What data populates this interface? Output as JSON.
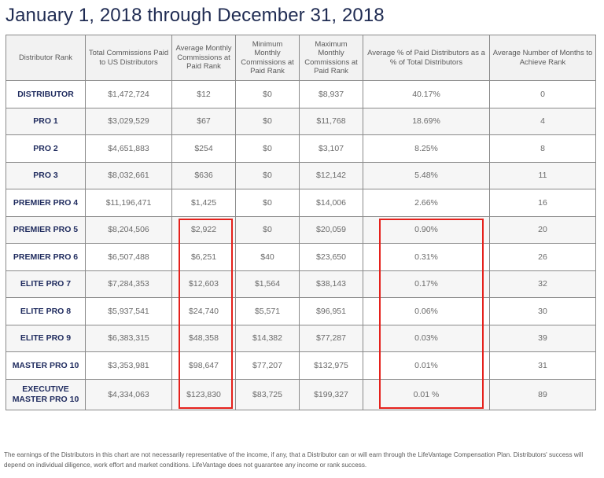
{
  "title": "January 1, 2018 through December 31, 2018",
  "table": {
    "headers": [
      "Distributor Rank",
      "Total Commissions Paid to US Distributors",
      "Average Monthly Commissions at Paid Rank",
      "Minimum Monthly Commissions at Paid Rank",
      "Maximum Monthly Commissions at Paid Rank",
      "Average % of Paid Distributors as a % of Total Distributors",
      "Average Number of Months to Achieve Rank"
    ],
    "rows": [
      {
        "rank": "DISTRIBUTOR",
        "total": "$1,472,724",
        "avg": "$12",
        "min": "$0",
        "max": "$8,937",
        "pct": "40.17%",
        "months": "0"
      },
      {
        "rank": "PRO 1",
        "total": "$3,029,529",
        "avg": "$67",
        "min": "$0",
        "max": "$11,768",
        "pct": "18.69%",
        "months": "4"
      },
      {
        "rank": "PRO 2",
        "total": "$4,651,883",
        "avg": "$254",
        "min": "$0",
        "max": "$3,107",
        "pct": "8.25%",
        "months": "8"
      },
      {
        "rank": "PRO 3",
        "total": "$8,032,661",
        "avg": "$636",
        "min": "$0",
        "max": "$12,142",
        "pct": "5.48%",
        "months": "11"
      },
      {
        "rank": "PREMIER PRO 4",
        "total": "$11,196,471",
        "avg": "$1,425",
        "min": "$0",
        "max": "$14,006",
        "pct": "2.66%",
        "months": "16"
      },
      {
        "rank": "PREMIER PRO 5",
        "total": "$8,204,506",
        "avg": "$2,922",
        "min": "$0",
        "max": "$20,059",
        "pct": "0.90%",
        "months": "20"
      },
      {
        "rank": "PREMIER PRO 6",
        "total": "$6,507,488",
        "avg": "$6,251",
        "min": "$40",
        "max": "$23,650",
        "pct": "0.31%",
        "months": "26"
      },
      {
        "rank": "ELITE PRO 7",
        "total": "$7,284,353",
        "avg": "$12,603",
        "min": "$1,564",
        "max": "$38,143",
        "pct": "0.17%",
        "months": "32"
      },
      {
        "rank": "ELITE PRO 8",
        "total": "$5,937,541",
        "avg": "$24,740",
        "min": "$5,571",
        "max": "$96,951",
        "pct": "0.06%",
        "months": "30"
      },
      {
        "rank": "ELITE PRO 9",
        "total": "$6,383,315",
        "avg": "$48,358",
        "min": "$14,382",
        "max": "$77,287",
        "pct": "0.03%",
        "months": "39"
      },
      {
        "rank": "MASTER PRO 10",
        "total": "$3,353,981",
        "avg": "$98,647",
        "min": "$77,207",
        "max": "$132,975",
        "pct": "0.01%",
        "months": "31"
      },
      {
        "rank": "EXECUTIVE MASTER PRO 10",
        "total": "$4,334,063",
        "avg": "$123,830",
        "min": "$83,725",
        "max": "$199,327",
        "pct": "0.01 %",
        "months": "89"
      }
    ]
  },
  "highlights": {
    "color": "#e5211c",
    "columns": [
      "Average Monthly Commissions at Paid Rank",
      "Average % of Paid Distributors as a % of Total Distributors"
    ],
    "from_rank": "PREMIER PRO 5",
    "to_rank": "EXECUTIVE MASTER PRO 10"
  },
  "footnote": "The earnings of the Distributors in this chart are not necessarily representative of the income, if any, that a Distributor can or will earn through the LifeVantage Compensation Plan. Distributors' success will depend on individual diligence, work effort and market conditions. LifeVantage does not guarantee any income or rank success."
}
